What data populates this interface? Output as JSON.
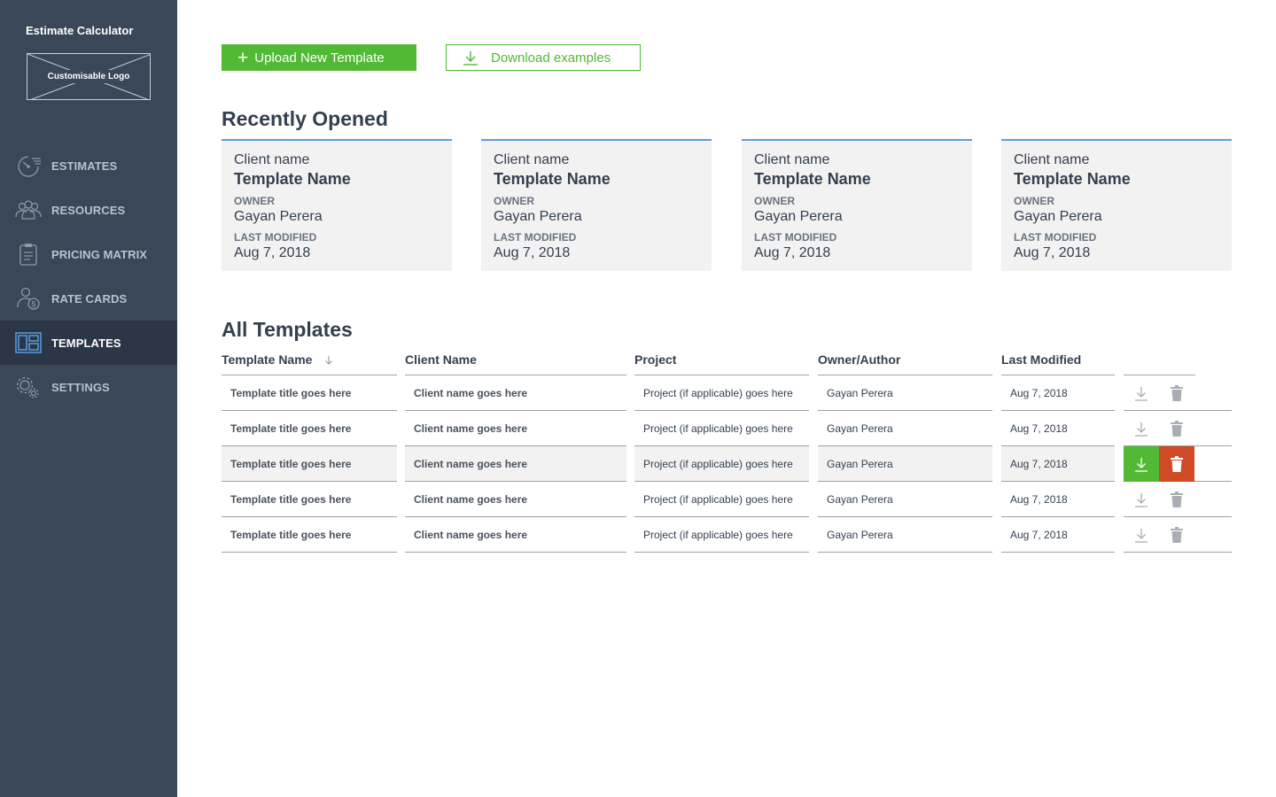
{
  "app": {
    "title": "Estimate Calculator",
    "logo_text": "Customisable Logo"
  },
  "nav": [
    {
      "label": "ESTIMATES",
      "icon": "speedometer-icon",
      "active": false
    },
    {
      "label": "RESOURCES",
      "icon": "people-icon",
      "active": false
    },
    {
      "label": "PRICING MATRIX",
      "icon": "clipboard-icon",
      "active": false
    },
    {
      "label": "RATE CARDS",
      "icon": "user-dollar-icon",
      "active": false
    },
    {
      "label": "TEMPLATES",
      "icon": "layout-icon",
      "active": true
    },
    {
      "label": "SETTINGS",
      "icon": "gears-icon",
      "active": false
    }
  ],
  "actions": {
    "upload_label": "Upload New Template",
    "download_label": "Download examples"
  },
  "recent": {
    "title": "Recently Opened",
    "owner_label": "OWNER",
    "modified_label": "LAST MODIFIED",
    "cards": [
      {
        "client": "Client name",
        "template": "Template Name",
        "owner": "Gayan Perera",
        "modified": "Aug 7, 2018"
      },
      {
        "client": "Client name",
        "template": "Template Name",
        "owner": "Gayan Perera",
        "modified": "Aug 7, 2018"
      },
      {
        "client": "Client name",
        "template": "Template Name",
        "owner": "Gayan Perera",
        "modified": "Aug 7, 2018"
      },
      {
        "client": "Client name",
        "template": "Template Name",
        "owner": "Gayan Perera",
        "modified": "Aug 7, 2018"
      }
    ]
  },
  "all": {
    "title": "All Templates",
    "columns": [
      "Template Name",
      "Client Name",
      "Project",
      "Owner/Author",
      "Last Modified"
    ],
    "sorted_column": "Template Name",
    "rows": [
      {
        "template": "Template title goes here",
        "client": "Client name goes here",
        "project": "Project (if applicable) goes here",
        "owner": "Gayan Perera",
        "modified": "Aug 7, 2018",
        "highlighted": false
      },
      {
        "template": "Template title goes here",
        "client": "Client name goes here",
        "project": "Project (if applicable) goes here",
        "owner": "Gayan Perera",
        "modified": "Aug 7, 2018",
        "highlighted": false
      },
      {
        "template": "Template title goes here",
        "client": "Client name goes here",
        "project": "Project (if applicable) goes here",
        "owner": "Gayan Perera",
        "modified": "Aug 7, 2018",
        "highlighted": true
      },
      {
        "template": "Template title goes here",
        "client": "Client name goes here",
        "project": "Project (if applicable) goes here",
        "owner": "Gayan Perera",
        "modified": "Aug 7, 2018",
        "highlighted": false
      },
      {
        "template": "Template title goes here",
        "client": "Client name goes here",
        "project": "Project (if applicable) goes here",
        "owner": "Gayan Perera",
        "modified": "Aug 7, 2018",
        "highlighted": false
      }
    ]
  },
  "colors": {
    "sidebar": "#394759",
    "sidebar_active": "#2b3647",
    "accent_green": "#52b934",
    "danger": "#d24a25",
    "card_border": "#5b9ee0"
  }
}
